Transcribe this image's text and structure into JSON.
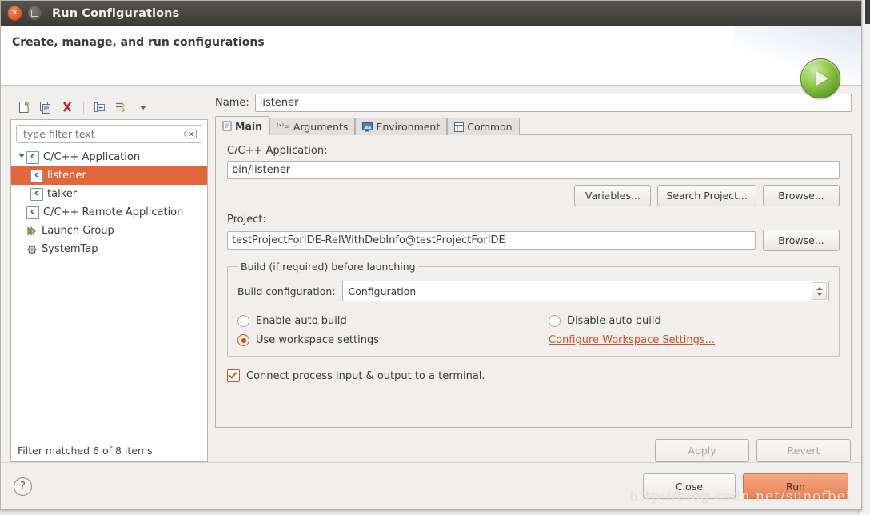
{
  "window": {
    "title": "Run Configurations",
    "close_tooltip": "Close",
    "maximize_tooltip": "Maximize"
  },
  "header": {
    "title": "Create, manage, and run configurations",
    "badge_icon": "run-green-circle-icon"
  },
  "left_panel": {
    "toolbar": [
      {
        "name": "new-launch-configuration-icon",
        "label": "New launch configuration"
      },
      {
        "name": "duplicate-icon",
        "label": "Duplicate"
      },
      {
        "name": "delete-icon",
        "label": "Delete"
      },
      {
        "name": "collapse-all-icon",
        "label": "Collapse All"
      },
      {
        "name": "filter-icon",
        "label": "Filter launch configurations"
      },
      {
        "name": "chevron-down-icon",
        "label": "Menu"
      }
    ],
    "filter": {
      "placeholder": "type filter text",
      "value": "",
      "clear_icon": "clear-filter-icon"
    },
    "tree": [
      {
        "label": "C/C++ Application",
        "icon": "c-app-icon",
        "level": 0,
        "expanded": true,
        "selected": false
      },
      {
        "label": "listener",
        "icon": "c-app-icon",
        "level": 1,
        "expanded": null,
        "selected": true
      },
      {
        "label": "talker",
        "icon": "c-app-icon",
        "level": 1,
        "expanded": null,
        "selected": false
      },
      {
        "label": "C/C++ Remote Application",
        "icon": "c-app-icon",
        "level": 0,
        "expanded": null,
        "selected": false
      },
      {
        "label": "Launch Group",
        "icon": "launch-group-icon",
        "level": 0,
        "expanded": null,
        "selected": false
      },
      {
        "label": "SystemTap",
        "icon": "systemtap-icon",
        "level": 0,
        "expanded": null,
        "selected": false
      }
    ],
    "status": "Filter matched 6 of 8 items"
  },
  "main": {
    "name_label": "Name:",
    "name_value": "listener",
    "tabs": [
      {
        "label": "Main",
        "icon": "document-icon",
        "active": true
      },
      {
        "label": "Arguments",
        "icon": "arguments-icon",
        "active": false
      },
      {
        "label": "Environment",
        "icon": "environment-icon",
        "active": false
      },
      {
        "label": "Common",
        "icon": "common-icon",
        "active": false
      }
    ],
    "application_label": "C/C++ Application:",
    "application_value": "bin/listener",
    "buttons": {
      "variables": "Variables...",
      "search_project": "Search Project...",
      "browse_app": "Browse...",
      "browse_project": "Browse..."
    },
    "project_label": "Project:",
    "project_value": "testProjectForIDE-RelWithDebInfo@testProjectForIDE",
    "build_group": {
      "legend": "Build (if required) before launching",
      "config_label": "Build configuration:",
      "config_value": "Configuration",
      "options": [
        {
          "label": "Enable auto build",
          "selected": false
        },
        {
          "label": "Disable auto build",
          "selected": false
        },
        {
          "label": "Use workspace settings",
          "selected": true
        }
      ],
      "workspace_link": "Configure Workspace Settings..."
    },
    "terminal_checkbox": {
      "label": "Connect process input & output to a terminal.",
      "checked": true
    },
    "apply_label": "Apply",
    "revert_label": "Revert"
  },
  "footer": {
    "help_icon": "help-icon",
    "close_label": "Close",
    "run_label": "Run"
  },
  "watermark": "http://blog.csdn.net/sunofbei"
}
